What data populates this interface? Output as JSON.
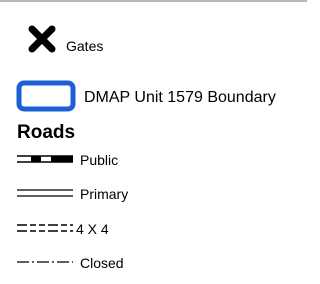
{
  "legend": {
    "items": [
      {
        "id": "gates",
        "symbol": "x-cross",
        "label": "Gates"
      },
      {
        "id": "boundary",
        "symbol": "blue-outline-rect",
        "color": "#1f5fd6",
        "label": "DMAP Unit 1579 Boundary"
      }
    ],
    "roads": {
      "heading": "Roads",
      "items": [
        {
          "id": "public",
          "symbol": "dashed-double-line",
          "label": "Public"
        },
        {
          "id": "primary",
          "symbol": "double-line",
          "label": "Primary"
        },
        {
          "id": "four_by_four",
          "symbol": "double-dashed-line",
          "label": "4 X 4"
        },
        {
          "id": "closed",
          "symbol": "dash-dot-line",
          "label": "Closed"
        }
      ]
    }
  }
}
